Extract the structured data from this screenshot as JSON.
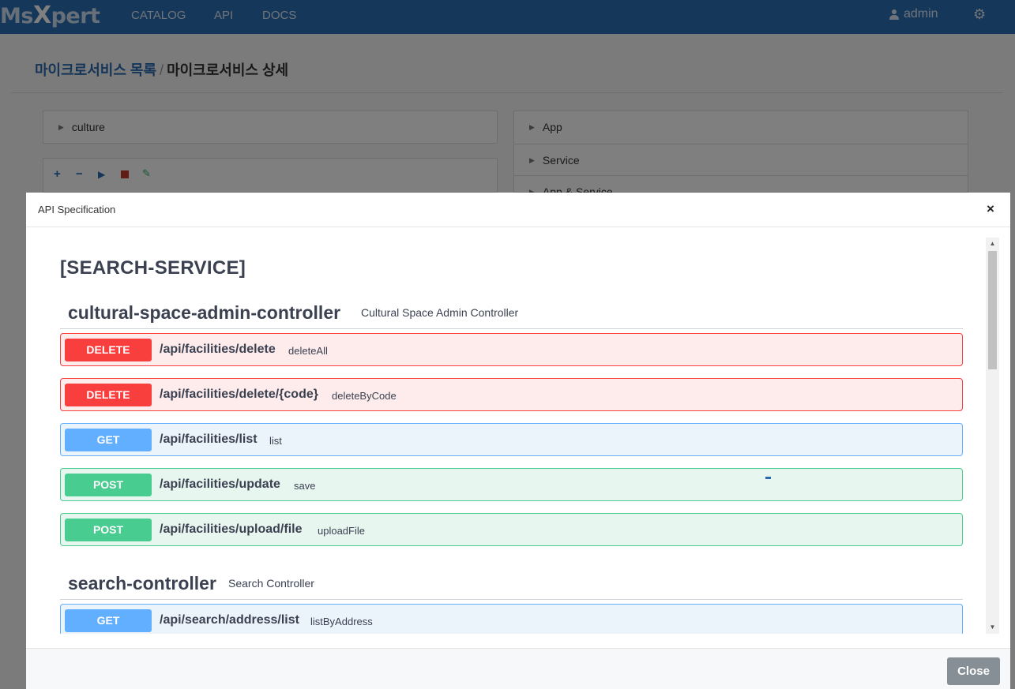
{
  "navbar": {
    "logo_prefix": "Ms",
    "logo_x": "X",
    "logo_suffix": "pert",
    "links": [
      "CATALOG",
      "API",
      "DOCS"
    ],
    "user": "admin",
    "user_icon": "user-icon",
    "settings_icon": "gear-icon"
  },
  "breadcrumb": {
    "first": "마이크로서비스 목록",
    "separator": "/",
    "current": "마이크로서비스 상세"
  },
  "left_panel": {
    "item": "culture",
    "toolbar_icons": [
      "plus-icon",
      "minus-icon",
      "play-icon",
      "stop-icon",
      "edit-icon"
    ]
  },
  "right_panel": {
    "items": [
      "App",
      "Service",
      "App & Service"
    ]
  },
  "modal": {
    "title": "API Specification",
    "close_x": "×",
    "service_title": "[SEARCH-SERVICE]",
    "close_button": "Close",
    "sections": [
      {
        "name": "cultural-space-admin-controller",
        "desc": "Cultural Space Admin Controller",
        "operations": [
          {
            "method": "DELETE",
            "path": "/api/facilities/delete",
            "summary": "deleteAll"
          },
          {
            "method": "DELETE",
            "path": "/api/facilities/delete/{code}",
            "summary": "deleteByCode"
          },
          {
            "method": "GET",
            "path": "/api/facilities/list",
            "summary": "list"
          },
          {
            "method": "POST",
            "path": "/api/facilities/update",
            "summary": "save"
          },
          {
            "method": "POST",
            "path": "/api/facilities/upload/file",
            "summary": "uploadFile"
          }
        ]
      },
      {
        "name": "search-controller",
        "desc": "Search Controller",
        "operations": [
          {
            "method": "GET",
            "path": "/api/search/address/list",
            "summary": "listByAddress"
          }
        ]
      }
    ]
  },
  "colors": {
    "navbar": "#2a6fb5",
    "delete": "#f93e3e",
    "get": "#61affe",
    "post": "#49cc90",
    "close_button": "#868e96"
  }
}
